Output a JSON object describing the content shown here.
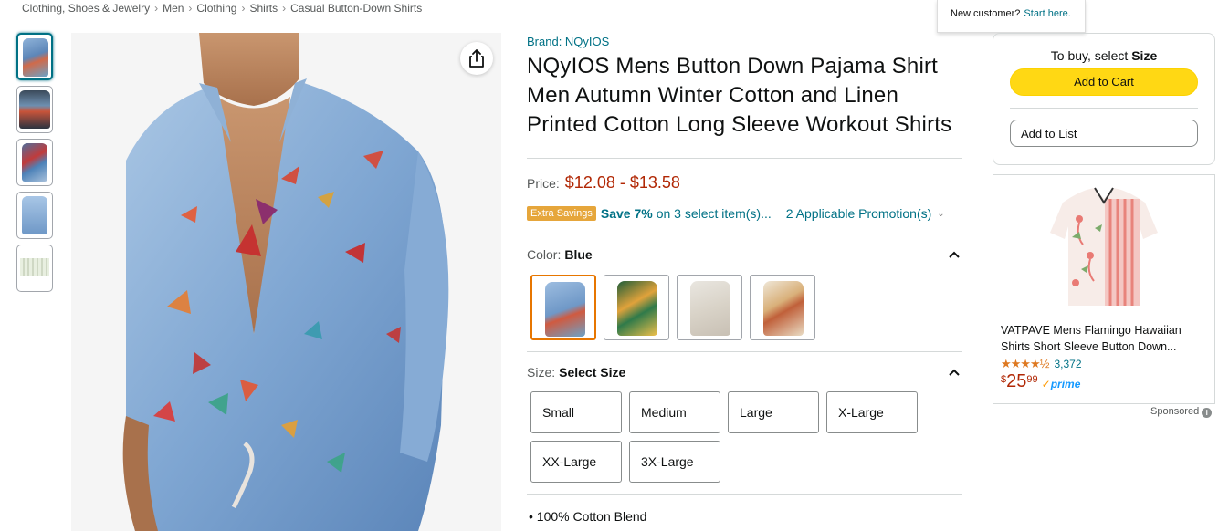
{
  "breadcrumb": [
    "Clothing, Shoes & Jewelry",
    "Men",
    "Clothing",
    "Shirts",
    "Casual Button-Down Shirts"
  ],
  "breadcrumb_sep": "›",
  "popover": {
    "question": "New customer?",
    "link": "Start here."
  },
  "product": {
    "brand": "Brand: NQyIOS",
    "title": "NQyIOS Mens Button Down Pajama Shirt Men Autumn Winter Cotton and Linen Printed Cotton Long Sleeve Workout Shirts",
    "price_label": "Price:",
    "price": "$12.08 - $13.58",
    "promo": {
      "badge": "Extra Savings",
      "save": "Save 7%",
      "save_on": "on 3 select item(s)...",
      "promotions": "2 Applicable Promotion(s)"
    },
    "color": {
      "label": "Color:",
      "selected": "Blue"
    },
    "size": {
      "label": "Size:",
      "selected": "Select Size",
      "options": [
        "Small",
        "Medium",
        "Large",
        "X-Large",
        "XX-Large",
        "3X-Large"
      ]
    },
    "bullet_first": "100% Cotton Blend"
  },
  "buybox": {
    "prompt": "To buy, select",
    "prompt_bold": "Size",
    "add_to_cart": "Add to Cart",
    "add_to_list": "Add to List"
  },
  "ad": {
    "title": "VATPAVE Mens Flamingo Hawaiian Shirts Short Sleeve Button Down...",
    "stars": "★★★★½",
    "rating_count": "3,372",
    "price_currency": "$",
    "price_whole": "25",
    "price_fraction": "99",
    "prime": "prime",
    "sponsored": "Sponsored"
  },
  "colors": {
    "link": "#007185",
    "price": "#b12704",
    "cart": "#ffd814",
    "selected_swatch": "#e77600"
  },
  "icons": [
    "share-icon",
    "chevron-down-icon",
    "chevron-up-icon",
    "star-icon",
    "info-icon"
  ]
}
